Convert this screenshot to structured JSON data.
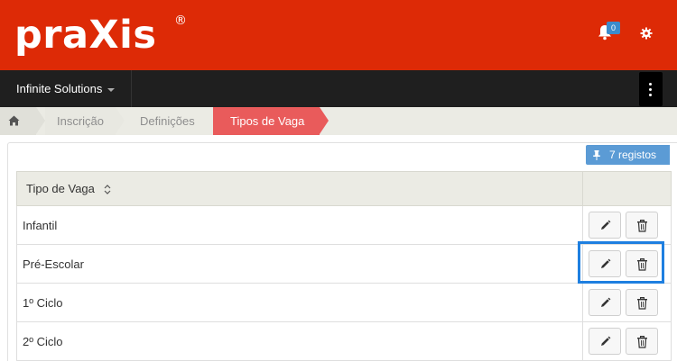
{
  "header": {
    "logo": "praXis",
    "logo_mark": "®",
    "notifications_count": "0",
    "icons": [
      "bell-icon",
      "gear-icon"
    ],
    "brand_color": "#dd2a06"
  },
  "navbar": {
    "org_label": "Infinite Solutions",
    "menu_icon": "kebab-icon"
  },
  "breadcrumb": {
    "home_icon": "home-icon",
    "items": [
      "Inscrição",
      "Definições",
      "Tipos de Vaga"
    ]
  },
  "records": {
    "label": "7 registos",
    "icon": "pin-icon"
  },
  "table": {
    "column": "Tipo de Vaga",
    "rows": [
      "Infantil",
      "Pré-Escolar",
      "1º Ciclo",
      "2º Ciclo"
    ],
    "row_actions": [
      "pencil-icon",
      "trash-icon"
    ]
  }
}
